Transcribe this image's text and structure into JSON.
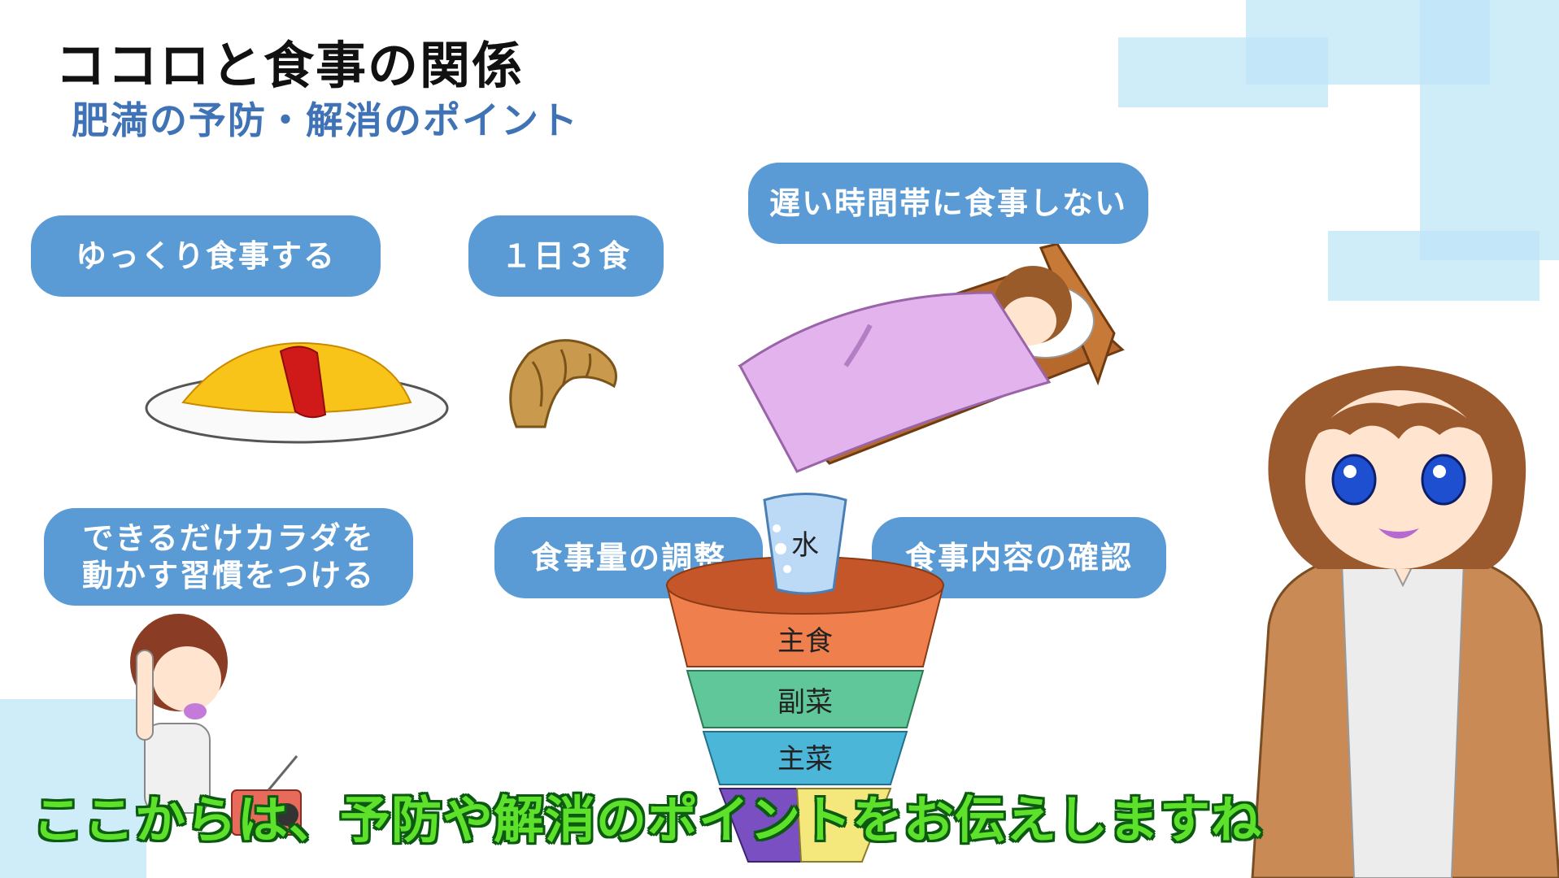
{
  "slide": {
    "title": "ココロと食事の関係",
    "subtitle": "肥満の予防・解消のポイント"
  },
  "points": {
    "eat_slowly": "ゆっくり食事する",
    "three_meals": "１日３食",
    "not_late": "遅い時間帯に食事しない",
    "exercise_line1": "できるだけカラダを",
    "exercise_line2": "動かす習慣をつける",
    "amount": "食事量の調整",
    "content": "食事内容の確認"
  },
  "food_pyramid": {
    "water": "水",
    "layers": [
      "主食",
      "副菜",
      "主菜"
    ]
  },
  "caption": "ここからは、予防や解消のポイントをお伝えしますね",
  "colors": {
    "pill": "#5b9bd5",
    "subtitle": "#3f73b6",
    "caption": "#5ee12a",
    "layer_staple": "#f07f4e",
    "layer_side": "#5fc79a",
    "layer_main": "#4bb6d8"
  }
}
